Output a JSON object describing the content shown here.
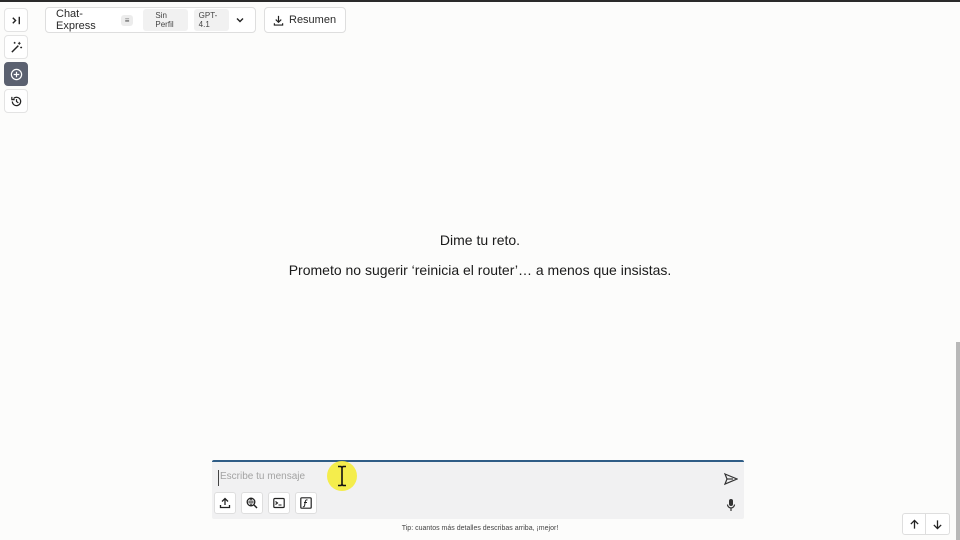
{
  "sidebar": {
    "items": [
      {
        "icon": "expand-panel-icon"
      },
      {
        "icon": "magic-wand-icon"
      },
      {
        "icon": "new-chat-plus-icon",
        "active": true
      },
      {
        "icon": "history-icon"
      }
    ]
  },
  "header": {
    "model_selector": {
      "name": "Chat-Express",
      "badge": "≡",
      "profile": "Sin Perfil",
      "model": "GPT-4.1"
    },
    "summary_button": "Resumen"
  },
  "main": {
    "greeting_line1": "Dime tu reto.",
    "greeting_line2": "Prometo no sugerir ‘reinicia el router’… a menos que insistas."
  },
  "composer": {
    "placeholder": "Escribe tu mensaje",
    "accent_color": "#2f5d86",
    "tools": [
      {
        "icon": "upload-icon"
      },
      {
        "icon": "web-search-icon"
      },
      {
        "icon": "terminal-icon"
      },
      {
        "icon": "function-icon"
      }
    ]
  },
  "footer": {
    "tip": "Tip: cuantos más detalles describas arriba, ¡mejor!"
  }
}
